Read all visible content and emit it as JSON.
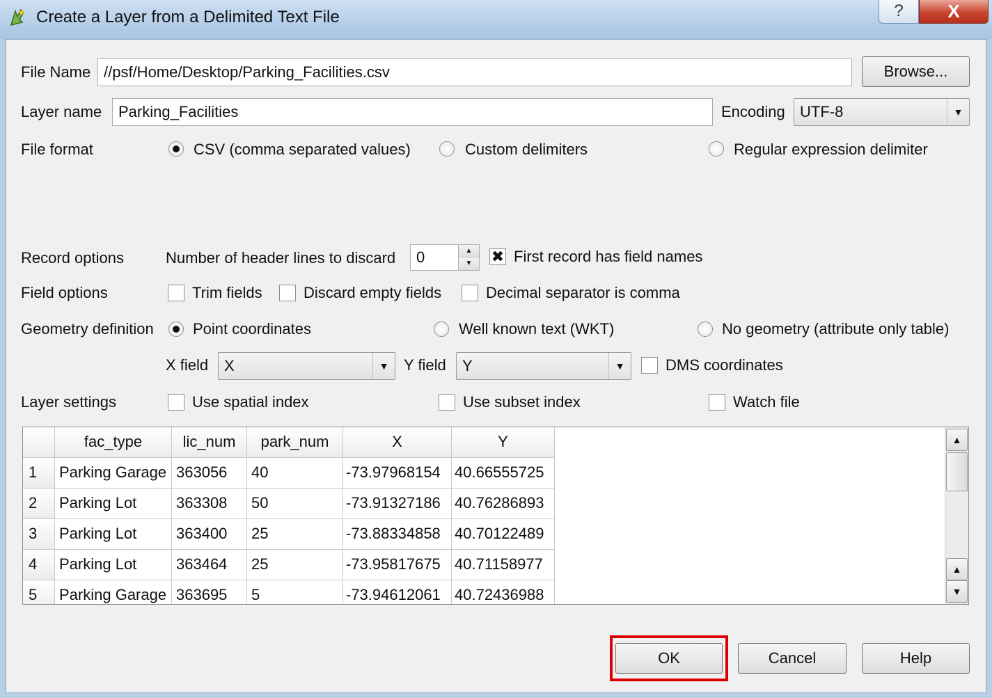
{
  "window": {
    "title": "Create a Layer from a Delimited Text File",
    "help_glyph": "?",
    "close_glyph": "X"
  },
  "file": {
    "label": "File Name",
    "value": "//psf/Home/Desktop/Parking_Facilities.csv",
    "browse_label": "Browse..."
  },
  "layer": {
    "label": "Layer name",
    "value": "Parking_Facilities",
    "encoding_label": "Encoding",
    "encoding_value": "UTF-8"
  },
  "file_format": {
    "label": "File format",
    "options": [
      "CSV (comma separated values)",
      "Custom delimiters",
      "Regular expression delimiter"
    ],
    "selected": "CSV (comma separated values)"
  },
  "record_options": {
    "label": "Record options",
    "header_lines_label": "Number of header lines to discard",
    "header_lines_value": "0",
    "first_record_label": "First record has field names",
    "first_record_checked": true
  },
  "field_options": {
    "label": "Field options",
    "trim": "Trim fields",
    "discard_empty": "Discard empty fields",
    "decimal_comma": "Decimal separator is comma"
  },
  "geometry": {
    "label": "Geometry definition",
    "options": [
      "Point coordinates",
      "Well known text (WKT)",
      "No geometry (attribute only table)"
    ],
    "selected": "Point coordinates",
    "x_field_label": "X field",
    "x_field_value": "X",
    "y_field_label": "Y field",
    "y_field_value": "Y",
    "dms_label": "DMS coordinates"
  },
  "layer_settings": {
    "label": "Layer settings",
    "spatial_index": "Use spatial index",
    "subset_index": "Use subset index",
    "watch_file": "Watch file"
  },
  "table": {
    "columns": [
      "fac_type",
      "lic_num",
      "park_num",
      "X",
      "Y"
    ],
    "rows": [
      {
        "n": "1",
        "cells": [
          "Parking Garage",
          "363056",
          "40",
          "-73.97968154",
          "40.66555725"
        ]
      },
      {
        "n": "2",
        "cells": [
          "Parking Lot",
          "363308",
          "50",
          "-73.91327186",
          "40.76286893"
        ]
      },
      {
        "n": "3",
        "cells": [
          "Parking Lot",
          "363400",
          "25",
          "-73.88334858",
          "40.70122489"
        ]
      },
      {
        "n": "4",
        "cells": [
          "Parking Lot",
          "363464",
          "25",
          "-73.95817675",
          "40.71158977"
        ]
      },
      {
        "n": "5",
        "cells": [
          "Parking Garage",
          "363695",
          "5",
          "-73.94612061",
          "40.72436988"
        ]
      }
    ]
  },
  "buttons": {
    "ok": "OK",
    "cancel": "Cancel",
    "help": "Help"
  },
  "colors": {
    "highlight": "#e00000"
  }
}
